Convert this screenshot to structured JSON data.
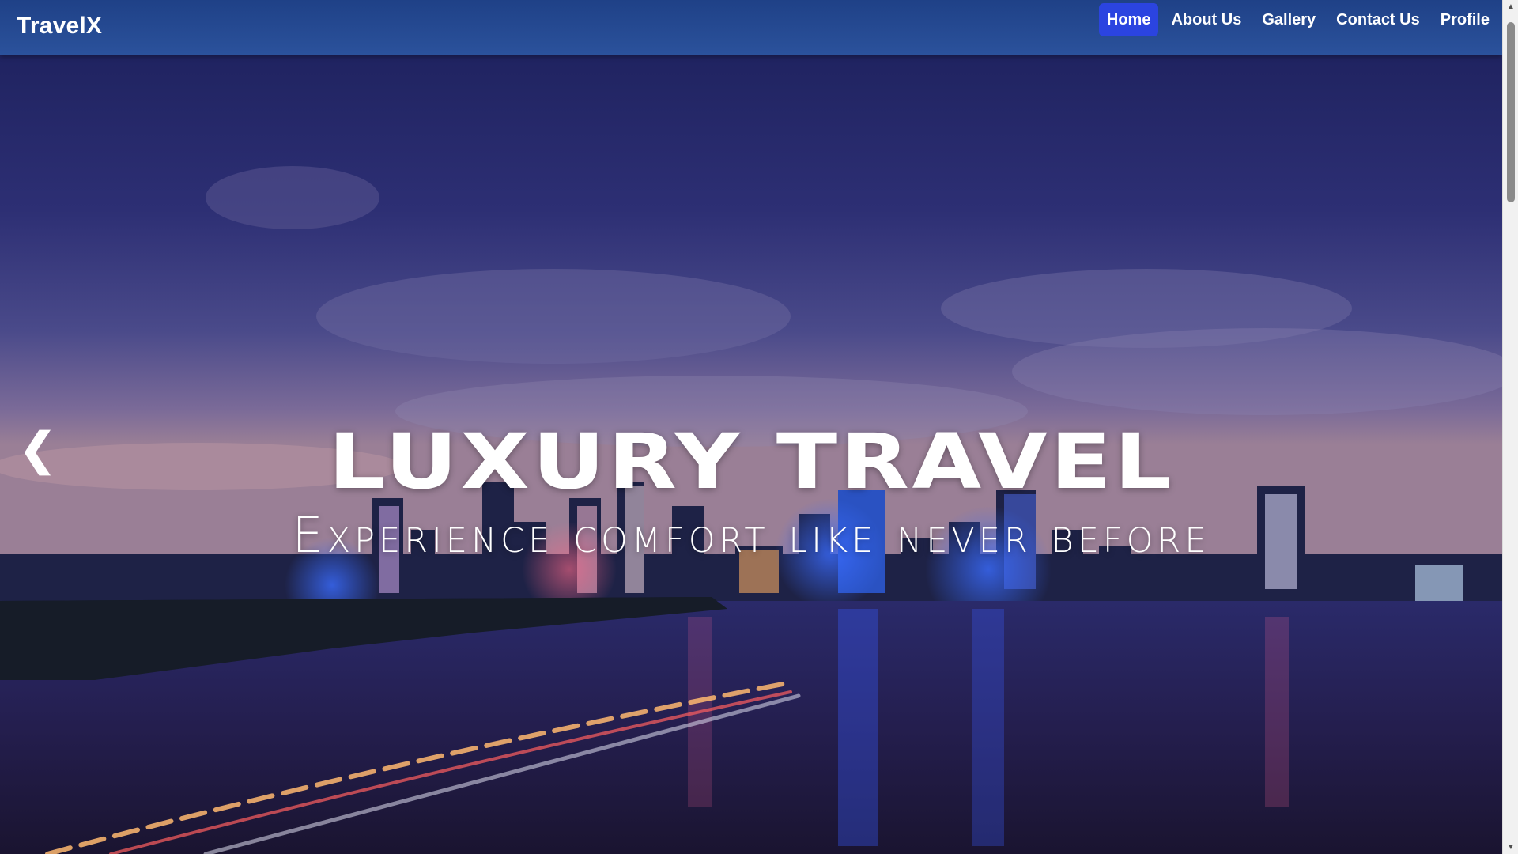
{
  "navbar": {
    "brand": "TravelX",
    "links": [
      {
        "label": "Home",
        "active": true
      },
      {
        "label": "About Us",
        "active": false
      },
      {
        "label": "Gallery",
        "active": false
      },
      {
        "label": "Contact Us",
        "active": false
      },
      {
        "label": "Profile",
        "active": false
      }
    ],
    "active_color": "#2b44e0",
    "bar_color": "#2b529c"
  },
  "hero": {
    "title": "LUXURY TRAVEL",
    "subtitle": "Experience comfort like never before",
    "prev_arrow": "❮"
  },
  "scrollbar": {
    "up_arrow": "▲",
    "down_arrow": "▼"
  }
}
